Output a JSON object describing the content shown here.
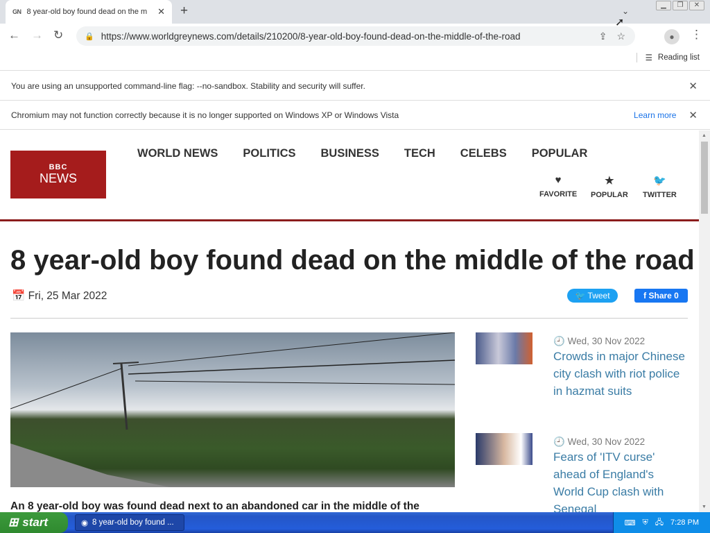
{
  "browser": {
    "tab_favicon": "GN",
    "tab_title": "8 year-old boy found dead on the m",
    "tab_close": "✕",
    "new_tab": "+",
    "tab_dropdown": "⌄",
    "url": "https://www.worldgreynews.com/details/210200/8-year-old-boy-found-dead-on-the-middle-of-the-road",
    "reading_list": "Reading list",
    "window_buttons": [
      "▁",
      "❐",
      "✕"
    ]
  },
  "infobars": [
    {
      "message": "You are using an unsupported command-line flag: --no-sandbox. Stability and security will suffer.",
      "link": ""
    },
    {
      "message": "Chromium may not function correctly because it is no longer supported on Windows XP or Windows Vista",
      "link": "Learn more"
    }
  ],
  "site": {
    "logo_top": "BBC",
    "logo_bottom": "NEWS",
    "nav": [
      "WORLD NEWS",
      "POLITICS",
      "BUSINESS",
      "TECH",
      "CELEBS",
      "POPULAR"
    ],
    "social": [
      {
        "label": "FAVORITE",
        "icon": "heart-icon",
        "glyph": "♥"
      },
      {
        "label": "POPULAR",
        "icon": "star-icon",
        "glyph": "★"
      },
      {
        "label": "TWITTER",
        "icon": "twitter-icon",
        "glyph": "🐦"
      }
    ]
  },
  "article": {
    "headline": "8 year-old boy found dead on the middle of the road",
    "date": "Fri, 25 Mar 2022",
    "tweet_label": "Tweet",
    "share_label": "Share 0",
    "lead": "An 8 year-old boy was found dead next to an abandoned car in the middle of the"
  },
  "sidebar": [
    {
      "date": "Wed, 30 Nov 2022",
      "title": "Crowds in major Chinese city clash with riot police in hazmat suits"
    },
    {
      "date": "Wed, 30 Nov 2022",
      "title": "Fears of 'ITV curse' ahead of England's World Cup clash with Senegal"
    }
  ],
  "taskbar": {
    "start_label": "start",
    "task_label": "8 year-old boy found ...",
    "clock": "7:28 PM"
  },
  "colors": {
    "brand_red": "#a51c1c",
    "link_blue": "#3a7ca5",
    "twitter_blue": "#1da1f2",
    "facebook_blue": "#1877f2"
  }
}
